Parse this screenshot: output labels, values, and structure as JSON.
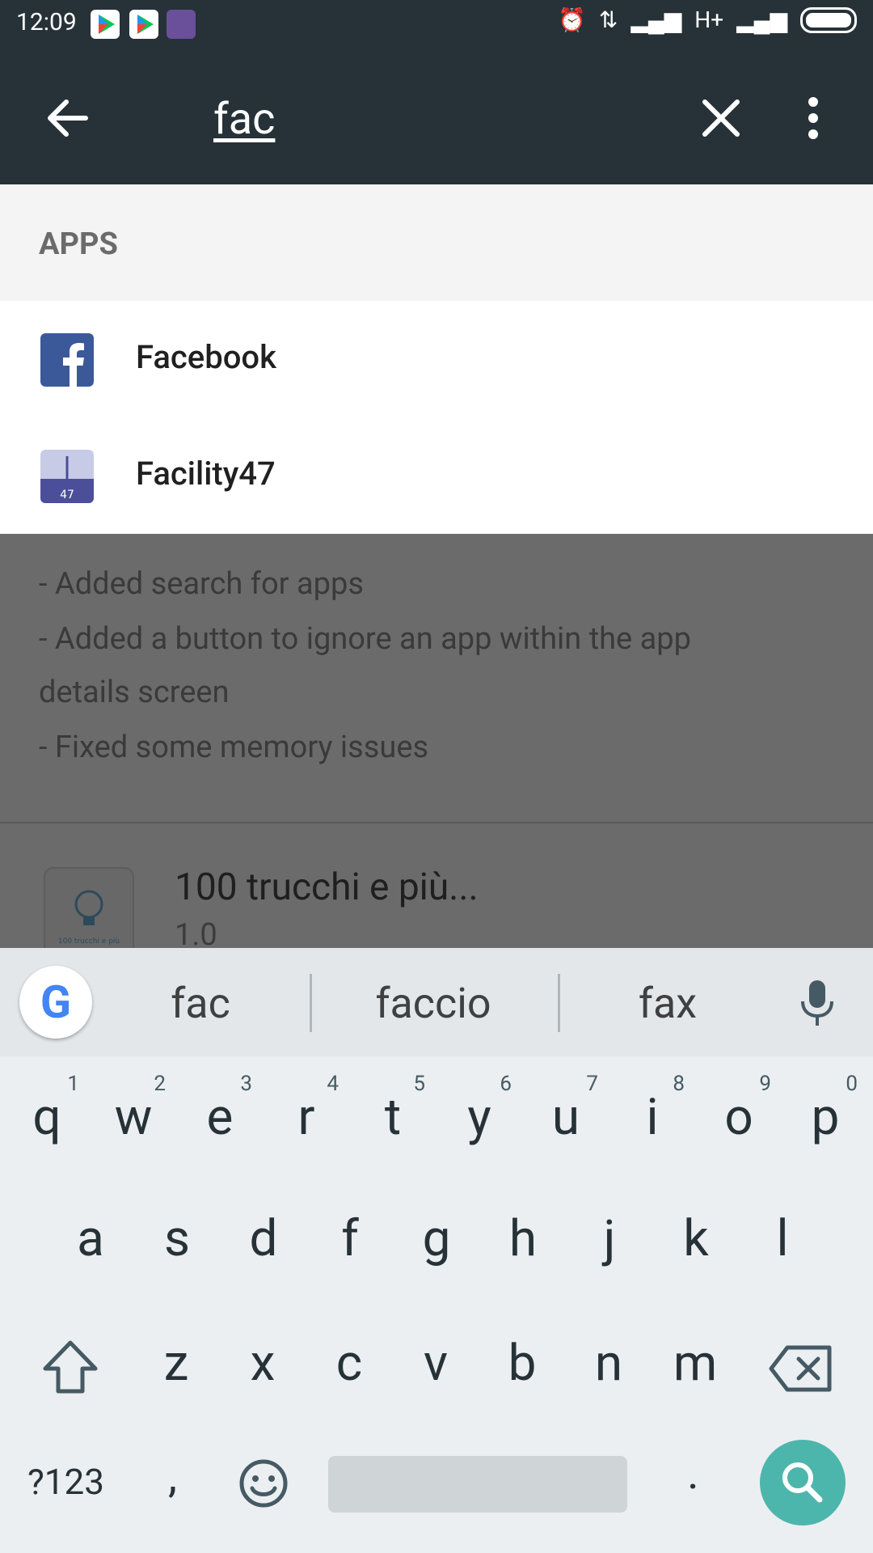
{
  "status_bar": {
    "time": "12:09",
    "network": "H+",
    "notifications": [
      "play-store-icon",
      "play-store-icon",
      "game-app-icon"
    ],
    "icons": [
      "alarm-icon",
      "data-transfer-icon",
      "signal-icon",
      "signal-icon",
      "battery-icon"
    ]
  },
  "toolbar": {
    "search_text": "fac",
    "back_icon": "arrow-left-icon",
    "clear_icon": "close-icon",
    "more_icon": "more-vertical-icon",
    "background_color": "#263238"
  },
  "suggestions": {
    "section_title": "APPS",
    "items": [
      {
        "label": "Facebook",
        "icon": "facebook-icon"
      },
      {
        "label": "Facility47",
        "icon": "facility47-icon"
      }
    ]
  },
  "background_content": {
    "lines": [
      "- Added search for apps",
      "- Added a button to ignore an app within the app",
      "details screen",
      "- Fixed some memory issues"
    ],
    "app": {
      "title": "100 trucchi e più...",
      "version": "1.0",
      "icon_caption": "100 trucchi e più"
    }
  },
  "keyboard": {
    "suggestions": [
      "fac",
      "faccio",
      "fax"
    ],
    "row1": [
      {
        "k": "q",
        "h": "1"
      },
      {
        "k": "w",
        "h": "2"
      },
      {
        "k": "e",
        "h": "3"
      },
      {
        "k": "r",
        "h": "4"
      },
      {
        "k": "t",
        "h": "5"
      },
      {
        "k": "y",
        "h": "6"
      },
      {
        "k": "u",
        "h": "7"
      },
      {
        "k": "i",
        "h": "8"
      },
      {
        "k": "o",
        "h": "9"
      },
      {
        "k": "p",
        "h": "0"
      }
    ],
    "row2": [
      "a",
      "s",
      "d",
      "f",
      "g",
      "h",
      "j",
      "k",
      "l"
    ],
    "row3": [
      "z",
      "x",
      "c",
      "v",
      "b",
      "n",
      "m"
    ],
    "symbols_key": "?123",
    "comma_key": ",",
    "period_key": ".",
    "accent_color": "#4db6ac"
  }
}
